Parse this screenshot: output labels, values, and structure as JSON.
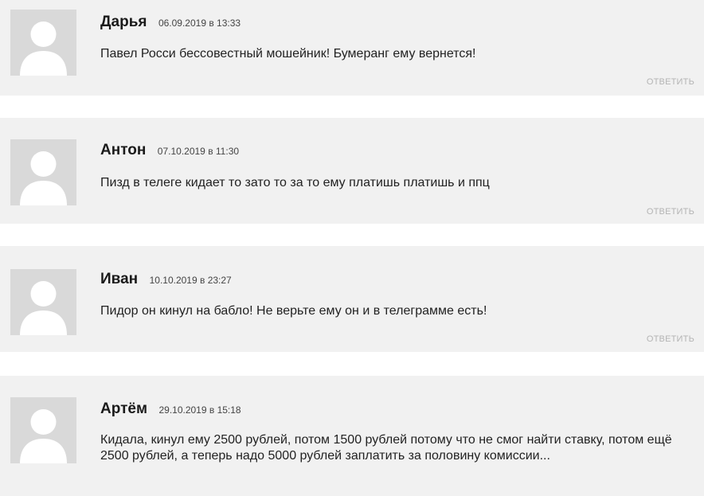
{
  "comments": [
    {
      "author": "Дарья",
      "date": "06.09.2019 в 13:33",
      "text": "Павел Росси бессовестный мошейник! Бумеранг ему вернется!",
      "reply_label": "ОТВЕТИТЬ",
      "avatar_icon": "user-silhouette-icon"
    },
    {
      "author": "Антон",
      "date": "07.10.2019 в 11:30",
      "text": "Пизд в телеге кидает то зато то за то ему платишь платишь и ппц",
      "reply_label": "ОТВЕТИТЬ",
      "avatar_icon": "user-silhouette-icon"
    },
    {
      "author": "Иван",
      "date": "10.10.2019 в 23:27",
      "text": "Пидор он кинул на бабло! Не верьте ему он и в телеграмме есть!",
      "reply_label": "ОТВЕТИТЬ",
      "avatar_icon": "user-silhouette-icon"
    },
    {
      "author": "Артём",
      "date": "29.10.2019 в 15:18",
      "text": "Кидала, кинул ему 2500 рублей, потом 1500 рублей потому что не смог найти ставку, потом ещё 2500 рублей, а теперь надо 5000 рублей заплатить за половину комиссии...",
      "avatar_icon": "user-silhouette-icon"
    }
  ],
  "colors": {
    "card_background": "#f1f1f1",
    "avatar_background": "#d9d9d9",
    "avatar_silhouette": "#ffffff",
    "reply_link": "#b4b4b4"
  }
}
